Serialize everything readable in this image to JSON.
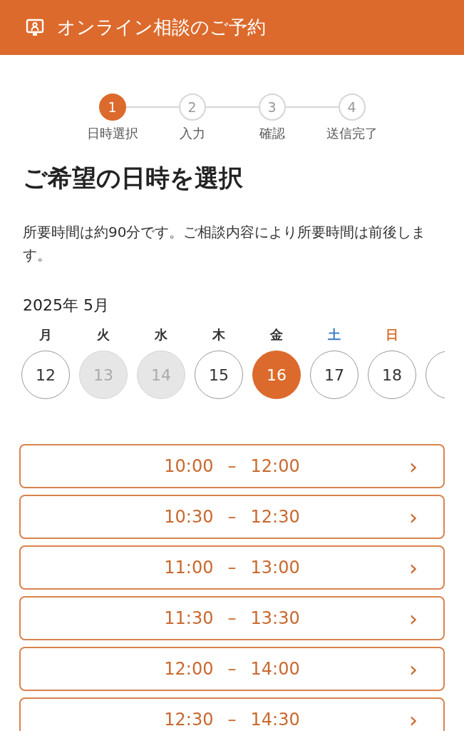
{
  "header": {
    "title": "オンライン相談のご予約"
  },
  "steps": [
    {
      "number": "1",
      "label": "日時選択",
      "selected": true
    },
    {
      "number": "2",
      "label": "入力",
      "selected": false
    },
    {
      "number": "3",
      "label": "確認",
      "selected": false
    },
    {
      "number": "4",
      "label": "送信完了",
      "selected": false
    }
  ],
  "heading": "ご希望の日時を選択",
  "description": "所要時間は約90分です。ご相談内容により所要時間は前後します。",
  "month": "2025年 5月",
  "days": [
    {
      "weekday": "月",
      "color": "#333333",
      "day": "12",
      "selected": false,
      "disabled": false
    },
    {
      "weekday": "火",
      "color": "#333333",
      "day": "13",
      "selected": false,
      "disabled": true
    },
    {
      "weekday": "水",
      "color": "#333333",
      "day": "14",
      "selected": false,
      "disabled": true
    },
    {
      "weekday": "木",
      "color": "#333333",
      "day": "15",
      "selected": false,
      "disabled": false
    },
    {
      "weekday": "金",
      "color": "#333333",
      "day": "16",
      "selected": true,
      "disabled": false
    },
    {
      "weekday": "土",
      "color": "#3a78c9",
      "day": "17",
      "selected": false,
      "disabled": false
    },
    {
      "weekday": "日",
      "color": "#d9702f",
      "day": "18",
      "selected": false,
      "disabled": false
    }
  ],
  "more_days_peek": true,
  "slots": [
    {
      "start": "10:00",
      "dash": "–",
      "end": "12:00",
      "chevron": "›"
    },
    {
      "start": "10:30",
      "dash": "–",
      "end": "12:30",
      "chevron": "›"
    },
    {
      "start": "11:00",
      "dash": "–",
      "end": "13:00",
      "chevron": "›"
    },
    {
      "start": "11:30",
      "dash": "–",
      "end": "13:30",
      "chevron": "›"
    },
    {
      "start": "12:00",
      "dash": "–",
      "end": "14:00",
      "chevron": "›"
    },
    {
      "start": "12:30",
      "dash": "–",
      "end": "14:30",
      "chevron": "›"
    }
  ]
}
